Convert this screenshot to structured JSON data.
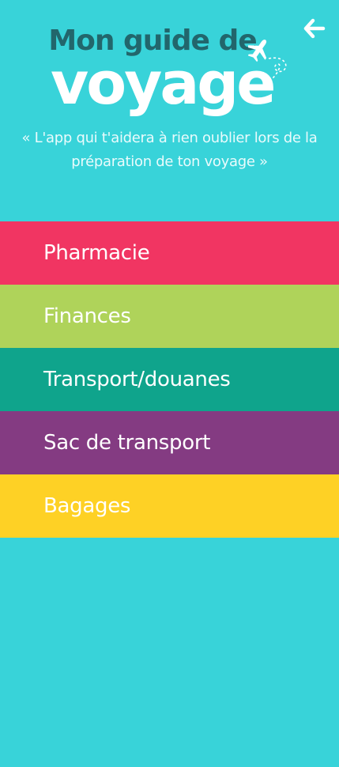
{
  "header": {
    "title_line1": "Mon guide de",
    "title_line2": "voyage",
    "tagline_line1": "« L'app qui t'aidera à rien oublier lors de la",
    "tagline_line2": "préparation de ton voyage »",
    "back_icon": "arrow-left-icon",
    "plane_icon": "airplane-icon"
  },
  "menu": {
    "items": [
      {
        "label": "Pharmacie",
        "color": "#f13562"
      },
      {
        "label": "Finances",
        "color": "#afd35a"
      },
      {
        "label": "Transport/douanes",
        "color": "#0fa48c"
      },
      {
        "label": "Sac de transport",
        "color": "#843b82"
      },
      {
        "label": "Bagages",
        "color": "#fed125"
      }
    ]
  },
  "colors": {
    "background": "#38d3d9",
    "title_dark": "#22666c",
    "title_light": "#ffffff"
  }
}
